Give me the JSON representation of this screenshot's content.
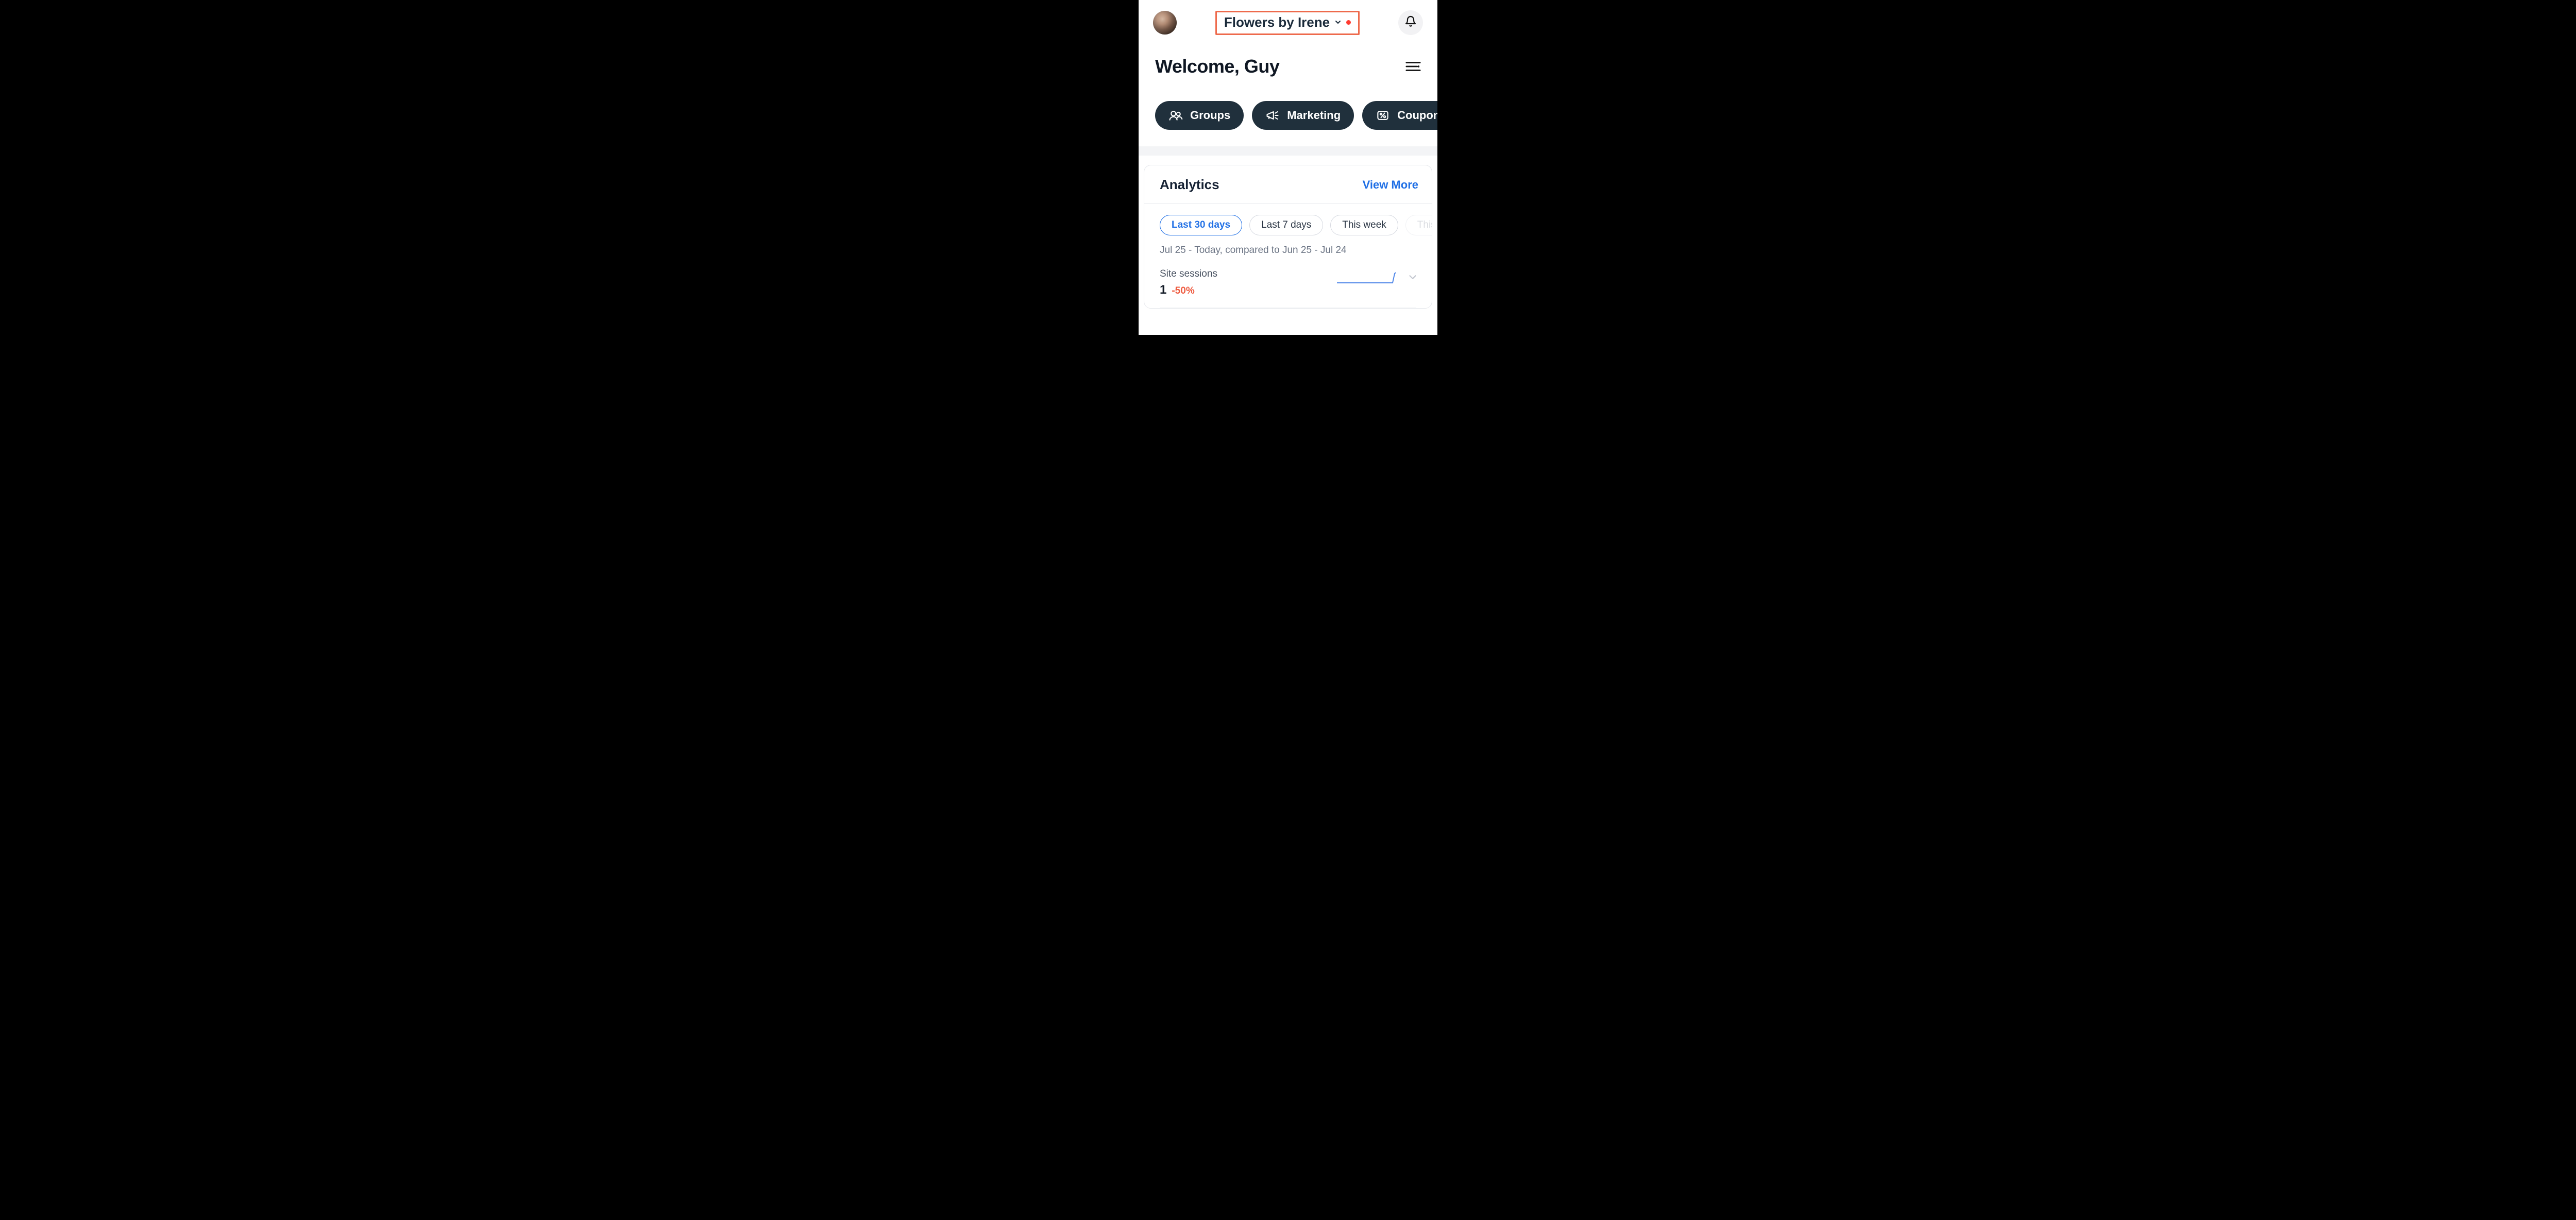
{
  "header": {
    "site_name": "Flowers by Irene",
    "has_notification_dot": true
  },
  "welcome_text": "Welcome, Guy",
  "quick_actions": [
    {
      "icon": "groups-icon",
      "label": "Groups"
    },
    {
      "icon": "megaphone-icon",
      "label": "Marketing"
    },
    {
      "icon": "coupon-icon",
      "label": "Coupons"
    }
  ],
  "analytics": {
    "title": "Analytics",
    "view_more_label": "View More",
    "ranges": [
      {
        "label": "Last 30 days",
        "active": true
      },
      {
        "label": "Last 7 days",
        "active": false
      },
      {
        "label": "This week",
        "active": false
      },
      {
        "label": "This",
        "active": false,
        "faded": true
      }
    ],
    "compare_text": "Jul 25 - Today, compared to Jun 25 - Jul 24",
    "metrics": [
      {
        "label": "Site sessions",
        "value": "1",
        "delta": "-50%"
      }
    ]
  },
  "colors": {
    "highlight_border": "#ee6a4c",
    "pill_bg": "#20303c",
    "link_blue": "#1f6fe5",
    "delta_negative": "#ee5a3f"
  }
}
